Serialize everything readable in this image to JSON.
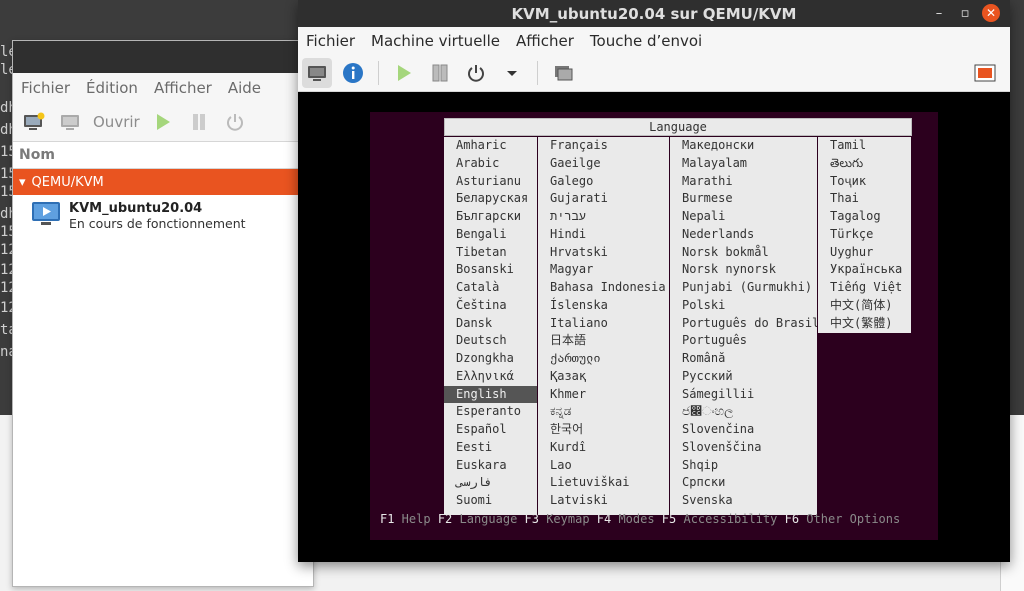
{
  "background": {
    "side_text": [
      "le",
      "le",
      "dh",
      "dh",
      "15",
      "15",
      "15",
      "dh",
      "15",
      "12",
      "12",
      "12",
      "12",
      "ta",
      "na"
    ]
  },
  "manager": {
    "menu": [
      "Fichier",
      "Édition",
      "Afficher",
      "Aide"
    ],
    "toolbar": {
      "open_label": "Ouvrir"
    },
    "column_header": "Nom",
    "group_label": "QEMU/KVM",
    "vm": {
      "name": "KVM_ubuntu20.04",
      "status": "En cours de fonctionnement"
    }
  },
  "console": {
    "title": "KVM_ubuntu20.04 sur QEMU/KVM",
    "menu": [
      "Fichier",
      "Machine virtuelle",
      "Afficher",
      "Touche d’envoi"
    ]
  },
  "installer": {
    "header": "Language",
    "columns": [
      [
        "Amharic",
        "Arabic",
        "Asturianu",
        "Беларуская",
        "Български",
        "Bengali",
        "Tibetan",
        "Bosanski",
        "Català",
        "Čeština",
        "Dansk",
        "Deutsch",
        "Dzongkha",
        "Ελληνικά",
        "English",
        "Esperanto",
        "Español",
        "Eesti",
        "Euskara",
        "فارسی",
        "Suomi"
      ],
      [
        "Français",
        "Gaeilge",
        "Galego",
        "Gujarati",
        "עברית",
        "Hindi",
        "Hrvatski",
        "Magyar",
        "Bahasa Indonesia",
        "Íslenska",
        "Italiano",
        "日本語",
        "ქართული",
        "Қазақ",
        "Khmer",
        "ಕನ್ನಡ",
        "한국어",
        "Kurdî",
        "Lao",
        "Lietuviškai",
        "Latviski"
      ],
      [
        "Македонски",
        "Malayalam",
        "Marathi",
        "Burmese",
        "Nepali",
        "Nederlands",
        "Norsk bokmål",
        "Norsk nynorsk",
        "Punjabi (Gurmukhi)",
        "Polski",
        "Português do Brasil",
        "Português",
        "Română",
        "Русский",
        "Sámegillii",
        "ජ෌ංහල",
        "Slovenčina",
        "Slovenščina",
        "Shqip",
        "Српски",
        "Svenska"
      ],
      [
        "Tamil",
        "తెలుగు",
        "Тоҷик",
        "Thai",
        "Tagalog",
        "Türkçe",
        "Uyghur",
        "Українська",
        "Tiếng Việt",
        "中文(简体)",
        "中文(繁體)"
      ]
    ],
    "selected": "English",
    "fkeys": [
      {
        "key": "F1",
        "label": "Help"
      },
      {
        "key": "F2",
        "label": "Language"
      },
      {
        "key": "F3",
        "label": "Keymap"
      },
      {
        "key": "F4",
        "label": "Modes"
      },
      {
        "key": "F5",
        "label": "Accessibility"
      },
      {
        "key": "F6",
        "label": "Other Options"
      }
    ]
  }
}
